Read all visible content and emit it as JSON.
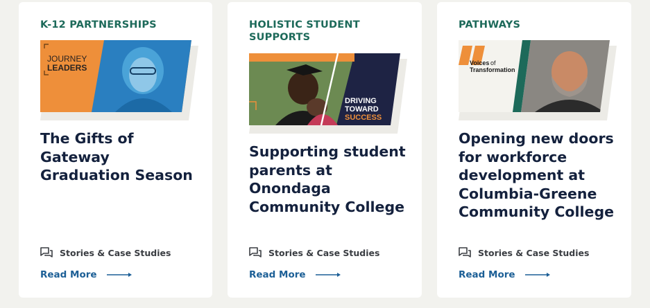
{
  "cards": [
    {
      "category": "K-12 PARTNERSHIPS",
      "image_text": [
        "JOURNEY",
        "LEADERS"
      ],
      "title": "The Gifts of Gateway Graduation Season",
      "meta_icon": "chat-bubbles-icon",
      "meta": "Stories & Case Studies",
      "read_more": "Read More"
    },
    {
      "category": "HOLISTIC STUDENT SUPPORTS",
      "image_text": [
        "DRIVING",
        "TOWARD",
        "SUCCESS"
      ],
      "title": "Supporting student parents at Onondaga Community College",
      "meta_icon": "chat-bubbles-icon",
      "meta": "Stories & Case Studies",
      "read_more": "Read More"
    },
    {
      "category": "PATHWAYS",
      "image_text": [
        "Voices",
        "of",
        "Transformation"
      ],
      "title": "Opening new doors for workforce development at Columbia-Greene Community College",
      "meta_icon": "chat-bubbles-icon",
      "meta": "Stories & Case Studies",
      "read_more": "Read More"
    }
  ],
  "colors": {
    "background": "#f2f2ee",
    "category": "#1d6a5a",
    "title": "#14213d",
    "link": "#1c5f96",
    "orange": "#ee8f3a",
    "navy": "#1e2344",
    "blue": "#2477b8"
  }
}
